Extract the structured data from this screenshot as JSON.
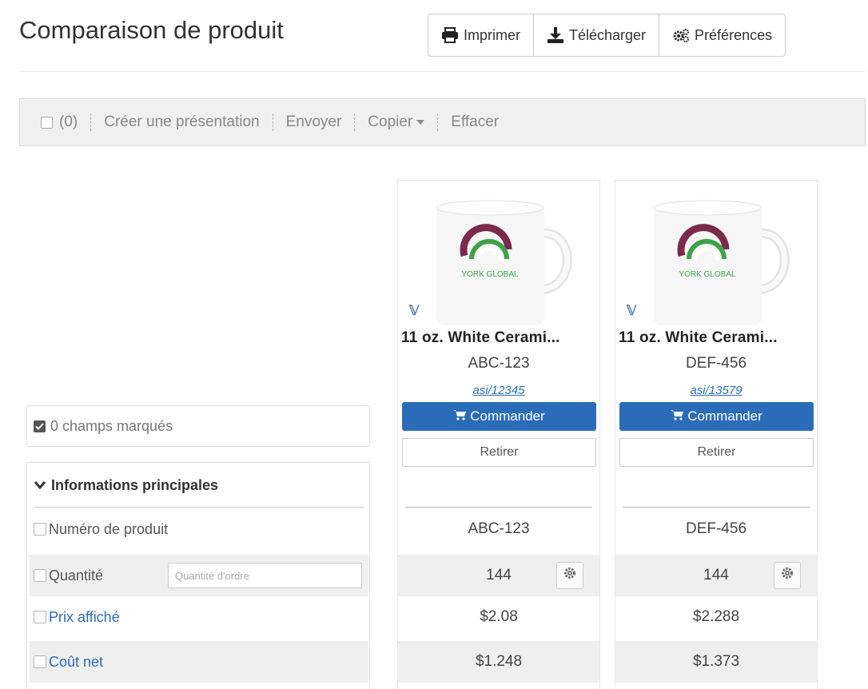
{
  "header": {
    "title": "Comparaison de produit",
    "buttons": [
      {
        "label": "Imprimer",
        "icon": "print-icon"
      },
      {
        "label": "Télécharger",
        "icon": "download-icon"
      },
      {
        "label": "Préférences",
        "icon": "gears-icon"
      }
    ]
  },
  "toolbar": {
    "count": "(0)",
    "create_presentation": "Créer une présentation",
    "send": "Envoyer",
    "copy": "Copier",
    "clear": "Effacer"
  },
  "marked_fields": "0 champs marqués",
  "section": {
    "title": "Informations principales",
    "rows": [
      {
        "label": "Numéro de produit",
        "link": false
      },
      {
        "label": "Quantité",
        "link": false,
        "placeholder": "Quantité d'ordre"
      },
      {
        "label": "Prix affiché",
        "link": true
      },
      {
        "label": "Coût net",
        "link": true
      }
    ]
  },
  "products": [
    {
      "name": "11 oz. White Cerami...",
      "code": "ABC-123",
      "asi": "asi/12345",
      "logo_text": "YORK GLOBAL",
      "order_label": "Commander",
      "remove_label": "Retirer",
      "product_number": "ABC-123",
      "quantity": "144",
      "listed_price": "$2.08",
      "net_cost": "$1.248"
    },
    {
      "name": "11 oz. White Cerami...",
      "code": "DEF-456",
      "asi": "asi/13579",
      "logo_text": "YORK GLOBAL",
      "order_label": "Commander",
      "remove_label": "Retirer",
      "product_number": "DEF-456",
      "quantity": "144",
      "listed_price": "$2.288",
      "net_cost": "$1.373"
    }
  ],
  "colors": {
    "primary": "#2b6cb8",
    "link": "#2a6db5",
    "logo_green": "#3fa24a",
    "logo_maroon": "#7a2a4a"
  }
}
